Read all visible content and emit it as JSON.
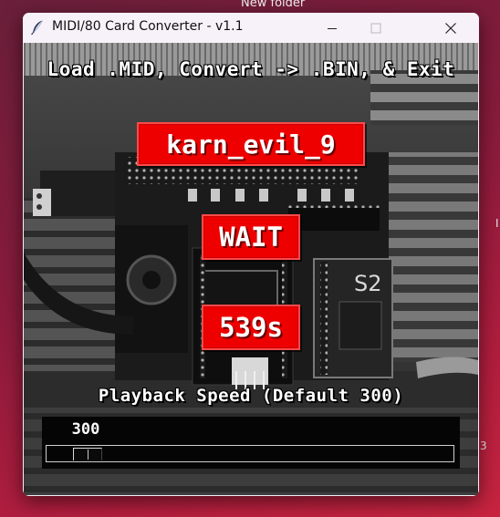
{
  "desktop": {
    "folder_label": "New folder",
    "right_edge_chars": [
      "I",
      "3"
    ]
  },
  "window": {
    "title": "MIDI/80 Card Converter - v1.1",
    "controls": {
      "minimize_icon": "minimize-icon",
      "maximize_icon": "maximize-icon",
      "close_icon": "close-icon"
    }
  },
  "main": {
    "headline": "Load .MID, Convert -> .BIN, & Exit",
    "file_button_label": "karn_evil_9",
    "status_label": "WAIT",
    "time_label": "539s",
    "speed": {
      "label": "Playback Speed (Default 300)",
      "value": "300",
      "min": 0,
      "max": 3000,
      "current": 300
    }
  },
  "colors": {
    "button_red": "#ee0000",
    "text_white": "#ffffff",
    "slider_bg": "#050505",
    "desktop_accent": "#b01d3e"
  }
}
